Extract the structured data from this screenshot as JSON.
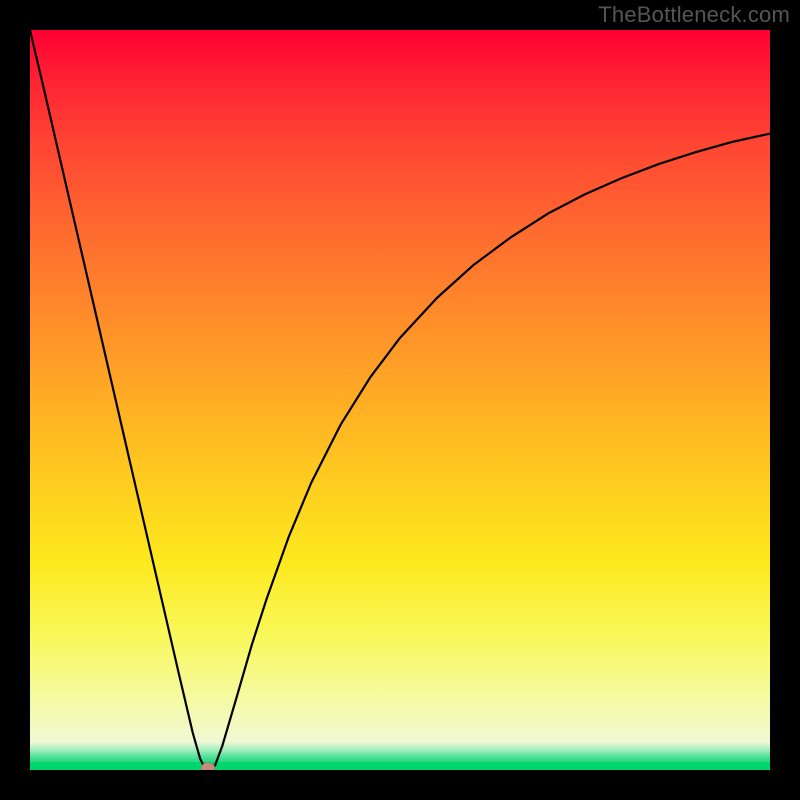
{
  "watermark": "TheBottleneck.com",
  "chart_data": {
    "type": "line",
    "title": "",
    "xlabel": "",
    "ylabel": "",
    "xlim": [
      0,
      100
    ],
    "ylim": [
      0,
      100
    ],
    "grid": false,
    "legend": false,
    "series": [
      {
        "name": "bottleneck-curve",
        "x": [
          0,
          2,
          5,
          8,
          11,
          14,
          17,
          20,
          22,
          23,
          23.5,
          24,
          24.5,
          25,
          26,
          27,
          28,
          30,
          32,
          35,
          38,
          42,
          46,
          50,
          55,
          60,
          65,
          70,
          75,
          80,
          85,
          90,
          95,
          100
        ],
        "values": [
          100,
          91.5,
          78.5,
          65.5,
          52.5,
          39.5,
          26.5,
          13.5,
          5,
          1.5,
          0.5,
          0.3,
          0.5,
          0.6,
          3.3,
          6.7,
          10.1,
          17,
          23.2,
          31.6,
          38.8,
          46.7,
          53.1,
          58.4,
          63.8,
          68.3,
          72,
          75.2,
          77.8,
          80,
          81.9,
          83.5,
          84.9,
          86
        ]
      }
    ],
    "minimum_marker": {
      "x": 24,
      "y": 0.3
    },
    "background_gradient": {
      "stops": [
        {
          "pos": 0.0,
          "color": "#ff0033"
        },
        {
          "pos": 0.15,
          "color": "#ff4433"
        },
        {
          "pos": 0.38,
          "color": "#ff8a2a"
        },
        {
          "pos": 0.62,
          "color": "#ffcf1f"
        },
        {
          "pos": 0.82,
          "color": "#f9f85b"
        },
        {
          "pos": 0.95,
          "color": "#f1f9c9"
        },
        {
          "pos": 1.0,
          "color": "#00d66e"
        }
      ]
    }
  }
}
